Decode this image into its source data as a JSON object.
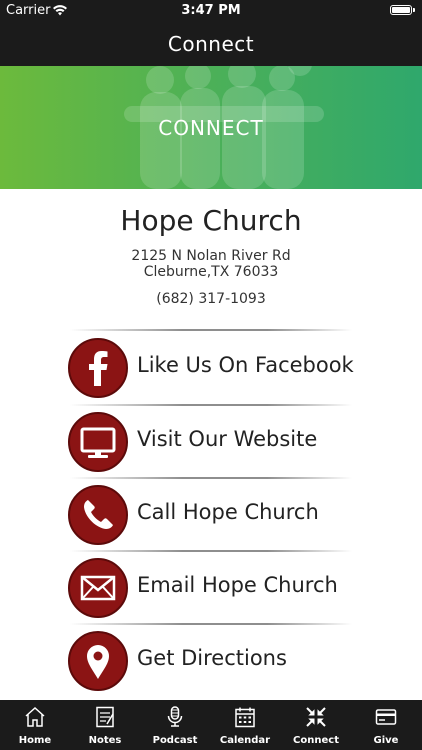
{
  "status_bar": {
    "carrier": "Carrier",
    "time": "3:47 PM"
  },
  "nav": {
    "title": "Connect"
  },
  "hero": {
    "label": "CONNECT"
  },
  "church": {
    "name": "Hope Church",
    "address_line1": "2125 N Nolan River Rd",
    "address_line2": "Cleburne,TX 76033",
    "phone": "(682) 317-1093"
  },
  "actions": [
    {
      "label": "Like Us On Facebook",
      "icon": "facebook-icon"
    },
    {
      "label": "Visit Our Website",
      "icon": "monitor-icon"
    },
    {
      "label": "Call Hope Church",
      "icon": "phone-icon"
    },
    {
      "label": "Email Hope Church",
      "icon": "envelope-icon"
    },
    {
      "label": "Get Directions",
      "icon": "map-pin-icon"
    }
  ],
  "tabs": [
    {
      "label": "Home",
      "icon": "house-icon"
    },
    {
      "label": "Notes",
      "icon": "notepad-icon"
    },
    {
      "label": "Podcast",
      "icon": "microphone-icon"
    },
    {
      "label": "Calendar",
      "icon": "calendar-icon"
    },
    {
      "label": "Connect",
      "icon": "connect-arrows-icon"
    },
    {
      "label": "Give",
      "icon": "card-icon"
    }
  ],
  "colors": {
    "bars": "#1b1b1b",
    "icon_circle": "#8b1414",
    "hero_left": "#6cba3c",
    "hero_right": "#2fa86c"
  }
}
